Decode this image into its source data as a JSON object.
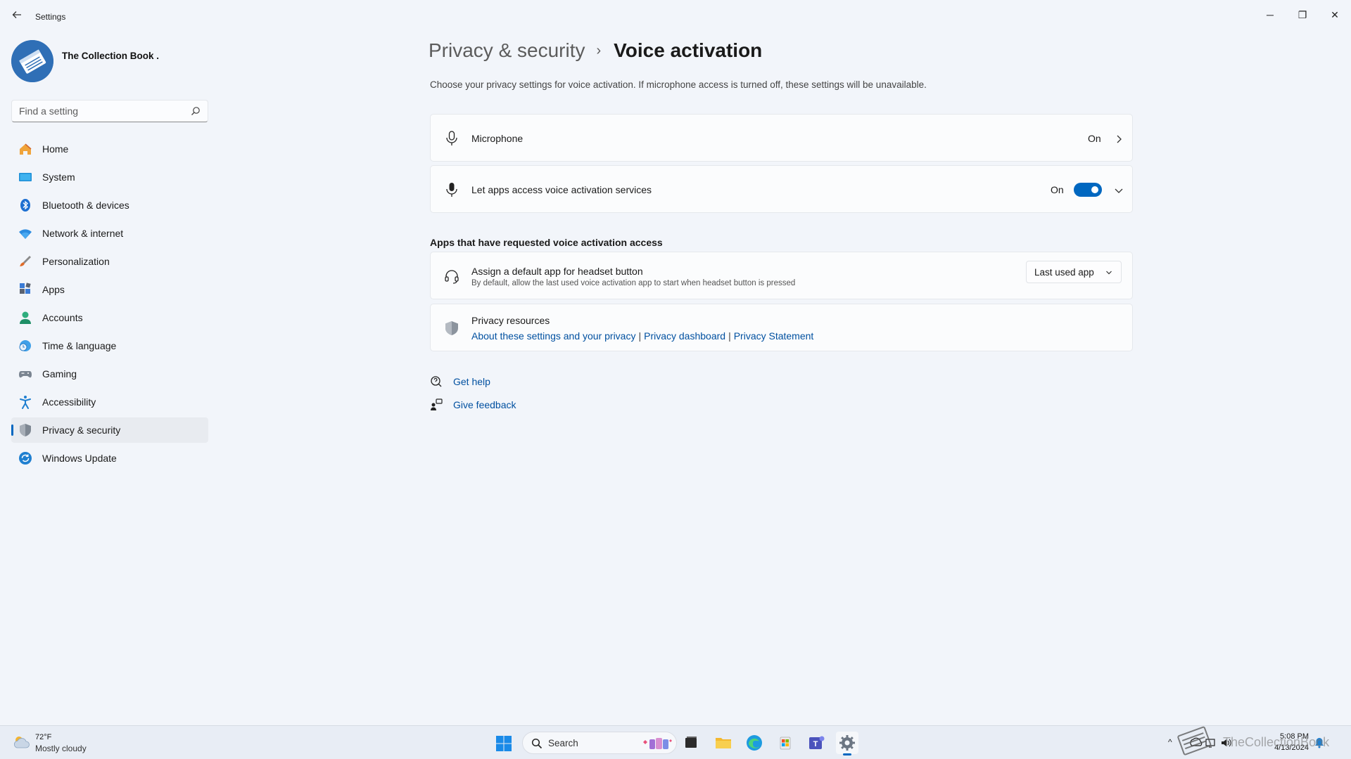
{
  "window": {
    "title": "Settings",
    "back_icon": "back-arrow-icon",
    "controls": {
      "minimize": "─",
      "maximize": "❐",
      "close": "✕"
    }
  },
  "profile": {
    "name": "The Collection Book ."
  },
  "search": {
    "placeholder": "Find a setting"
  },
  "sidebar": {
    "items": [
      {
        "label": "Home",
        "icon": "home-icon",
        "active": false
      },
      {
        "label": "System",
        "icon": "system-icon",
        "active": false
      },
      {
        "label": "Bluetooth & devices",
        "icon": "bluetooth-icon",
        "active": false
      },
      {
        "label": "Network & internet",
        "icon": "wifi-icon",
        "active": false
      },
      {
        "label": "Personalization",
        "icon": "brush-icon",
        "active": false
      },
      {
        "label": "Apps",
        "icon": "apps-icon",
        "active": false
      },
      {
        "label": "Accounts",
        "icon": "accounts-icon",
        "active": false
      },
      {
        "label": "Time & language",
        "icon": "clock-globe-icon",
        "active": false
      },
      {
        "label": "Gaming",
        "icon": "gamepad-icon",
        "active": false
      },
      {
        "label": "Accessibility",
        "icon": "accessibility-icon",
        "active": false
      },
      {
        "label": "Privacy & security",
        "icon": "shield-icon",
        "active": true
      },
      {
        "label": "Windows Update",
        "icon": "update-icon",
        "active": false
      }
    ]
  },
  "breadcrumb": {
    "parent": "Privacy & security",
    "separator": "›",
    "current": "Voice activation"
  },
  "description": "Choose your privacy settings for voice activation. If microphone access is turned off, these settings will be unavailable.",
  "settings": {
    "microphone": {
      "label": "Microphone",
      "status": "On"
    },
    "voice_services": {
      "label": "Let apps access voice activation services",
      "status": "On",
      "toggle_on": true
    }
  },
  "apps_section": {
    "title": "Apps that have requested voice activation access",
    "headset": {
      "title": "Assign a default app for headset button",
      "subtitle": "By default, allow the last used voice activation app to start when headset button is pressed",
      "dropdown_value": "Last used app"
    },
    "privacy_resources": {
      "title": "Privacy resources",
      "links": [
        "About these settings and your privacy",
        "Privacy dashboard",
        "Privacy Statement"
      ],
      "separator": "|"
    }
  },
  "help": {
    "get_help": "Get help",
    "give_feedback": "Give feedback"
  },
  "taskbar": {
    "weather": {
      "temp": "72°F",
      "desc": "Mostly cloudy"
    },
    "search_label": "Search",
    "tray": {
      "time": "5:08 PM",
      "date": "4/13/2024",
      "chevron": "^"
    },
    "watermark": "TheCollectionBook"
  },
  "colors": {
    "accent": "#0067c0",
    "link": "#0050a0",
    "background": "#f2f5fa"
  }
}
